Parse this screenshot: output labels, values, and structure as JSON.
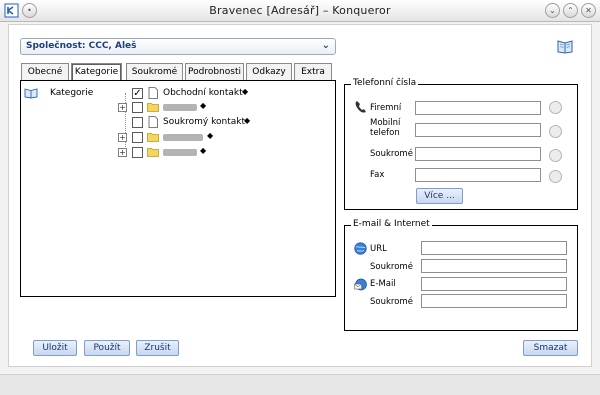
{
  "window": {
    "title": "Bravenec [Adresář] – Konqueror"
  },
  "company": {
    "value": "Společnost: CCC, Aleš"
  },
  "tabs": [
    {
      "label": "Obecné",
      "active": false
    },
    {
      "label": "Kategorie",
      "active": true
    },
    {
      "label": "Soukromé",
      "active": false
    },
    {
      "label": "Podrobnosti",
      "active": false
    },
    {
      "label": "Odkazy",
      "active": false
    },
    {
      "label": "Extra",
      "active": false
    }
  ],
  "tree": {
    "root_label": "Kategorie",
    "items": [
      {
        "label": "Obchodní kontakt",
        "checked": true,
        "expandable": false,
        "icon": "document-icon"
      },
      {
        "label": "",
        "checked": false,
        "expandable": true,
        "icon": "folder-icon"
      },
      {
        "label": "Soukromý kontakt",
        "checked": false,
        "expandable": false,
        "icon": "document-icon"
      },
      {
        "label": "",
        "checked": false,
        "expandable": true,
        "icon": "folder-icon"
      },
      {
        "label": "",
        "checked": false,
        "expandable": true,
        "icon": "folder-icon"
      }
    ]
  },
  "phones": {
    "legend": "Telefonní čísla",
    "rows": [
      {
        "label": "Firemní",
        "value": ""
      },
      {
        "label": "Mobilní telefon",
        "value": ""
      },
      {
        "label": "Soukromé",
        "value": ""
      },
      {
        "label": "Fax",
        "value": ""
      }
    ],
    "more_button": "Více ..."
  },
  "internet": {
    "legend": "E-mail & Internet",
    "rows": [
      {
        "label": "URL",
        "value": ""
      },
      {
        "label": "Soukromé",
        "value": ""
      },
      {
        "label": "E-Mail",
        "value": ""
      },
      {
        "label": "Soukromé",
        "value": ""
      }
    ]
  },
  "buttons": {
    "save": "Uložit",
    "apply": "Použít",
    "cancel": "Zrušit",
    "delete": "Smazat"
  },
  "colors": {
    "accent": "#1f3f7a",
    "button_bg": "#c7d7ef"
  }
}
